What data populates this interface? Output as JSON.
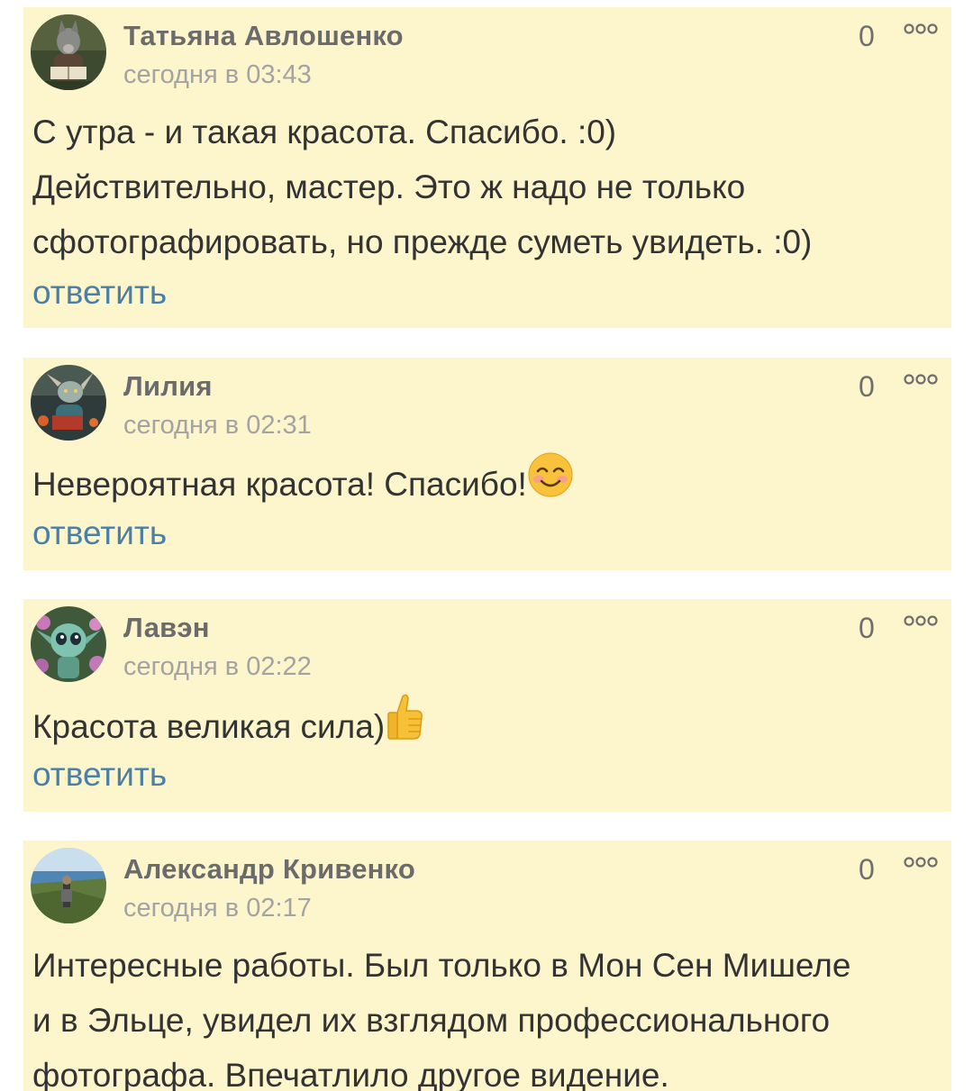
{
  "comments": [
    {
      "author": "Татьяна Авлошенко",
      "time": "сегодня в 03:43",
      "rating": "0",
      "text": [
        "С утра - и такая красота. Спасибо. :0)",
        "Действительно, мастер. Это ж надо не только",
        "сфотографировать, но прежде суметь увидеть. :0)"
      ],
      "reply": "ответить"
    },
    {
      "author": "Лилия",
      "time": "сегодня в 02:31",
      "rating": "0",
      "text": [
        "Невероятная красота! Спасибо!"
      ],
      "emoji": "smiling-face-emoji",
      "reply": "ответить"
    },
    {
      "author": "Лавэн",
      "time": "сегодня в 02:22",
      "rating": "0",
      "text": [
        "Красота великая сила)"
      ],
      "emoji": "thumbs-up-emoji",
      "reply": "ответить"
    },
    {
      "author": "Александр Кривенко",
      "time": "сегодня в 02:17",
      "rating": "0",
      "text": [
        "Интересные работы. Был только в Мон Сен Мишеле",
        "и в Эльце, увидел их взглядом профессионального",
        "фотографа. Впечатлило другое видение."
      ]
    }
  ],
  "colors": {
    "card_bg": "#fdf5cc",
    "author": "#6b6b6b",
    "time": "#a3a3a3",
    "text": "#333333",
    "reply_link": "#4a7fa7"
  }
}
